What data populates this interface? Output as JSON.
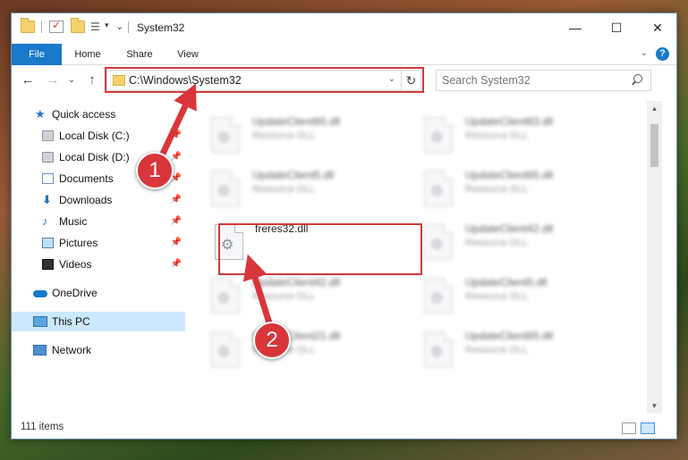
{
  "window": {
    "title": "System32",
    "minimize_glyph": "—",
    "maximize_glyph": "☐",
    "close_glyph": "✕",
    "qa_caret": "▾"
  },
  "ribbon": {
    "tabs": [
      "File",
      "Home",
      "Share",
      "View"
    ],
    "collapse_glyph": "⌄",
    "help_glyph": "?"
  },
  "address_bar": {
    "path": "C:\\Windows\\System32",
    "dropdown_glyph": "⌄",
    "refresh_glyph": "↻"
  },
  "nav_buttons": {
    "back": "←",
    "forward": "→",
    "history": "⌄",
    "up": "↑"
  },
  "search": {
    "placeholder": "Search System32"
  },
  "nav_pane": {
    "pin_glyph": "📌",
    "items": [
      {
        "label": "Quick access",
        "icon": "star-icon"
      },
      {
        "label": "Local Disk (C:)",
        "icon": "disk-icon",
        "pinned": true
      },
      {
        "label": "Local Disk (D:)",
        "icon": "disk-icon",
        "pinned": true
      },
      {
        "label": "Documents",
        "icon": "documents-icon",
        "pinned": true
      },
      {
        "label": "Downloads",
        "icon": "downloads-icon",
        "pinned": true
      },
      {
        "label": "Music",
        "icon": "music-icon",
        "pinned": true
      },
      {
        "label": "Pictures",
        "icon": "pictures-icon",
        "pinned": true
      },
      {
        "label": "Videos",
        "icon": "videos-icon",
        "pinned": true
      },
      {
        "label": "OneDrive",
        "icon": "onedrive-icon"
      },
      {
        "label": "This PC",
        "icon": "pc-icon",
        "selected": true
      },
      {
        "label": "Network",
        "icon": "network-icon"
      }
    ]
  },
  "files": {
    "gear_glyph": "⚙",
    "highlighted": {
      "name": "freres32.dll",
      "type": ""
    },
    "items": [
      {
        "name": "UpdateClient65.dll",
        "type": "Resource DLL"
      },
      {
        "name": "UpdateClient63.dll",
        "type": "Resource DLL"
      },
      {
        "name": "UpdateClient5.dll",
        "type": "Resource DLL"
      },
      {
        "name": "UpdateClient65.dll",
        "type": "Resource DLL"
      },
      {
        "name": "UpdateClient42.dll",
        "type": "Resource DLL"
      },
      {
        "name": "UpdateClient42.dll",
        "type": "Resource DLL"
      },
      {
        "name": "UpdateClient5.dll",
        "type": "Resource DLL"
      },
      {
        "name": "UpdateClient21.dll",
        "type": "Resource DLL"
      },
      {
        "name": "UpdateClient65.dll",
        "type": "Resource DLL"
      }
    ]
  },
  "scrollbar": {
    "up": "▲",
    "down": "▼"
  },
  "status_bar": {
    "item_count": "111 items"
  },
  "annotations": {
    "step1": "1",
    "step2": "2",
    "color": "#d8363a"
  }
}
